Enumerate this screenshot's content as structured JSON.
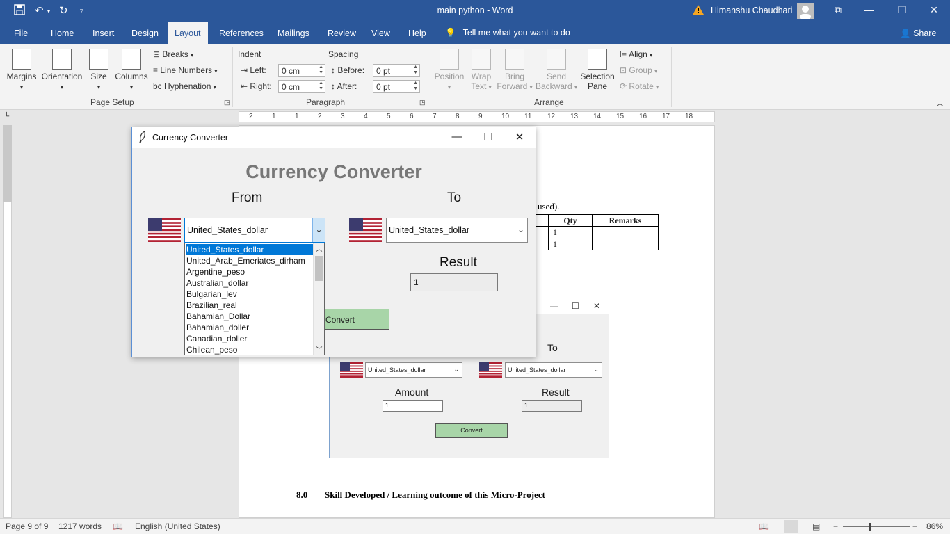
{
  "titlebar": {
    "doc_title": "main python  -  Word",
    "user_name": "Himanshu Chaudhari"
  },
  "tabs": [
    "File",
    "Home",
    "Insert",
    "Design",
    "Layout",
    "References",
    "Mailings",
    "Review",
    "View",
    "Help"
  ],
  "active_tab": "Layout",
  "tell_me": "Tell me what you want to do",
  "share": "Share",
  "ribbon": {
    "page_setup": {
      "label": "Page Setup",
      "margins": "Margins",
      "orientation": "Orientation",
      "size": "Size",
      "columns": "Columns",
      "breaks": "Breaks",
      "line_numbers": "Line Numbers",
      "hyphenation": "Hyphenation"
    },
    "paragraph": {
      "label": "Paragraph",
      "indent": "Indent",
      "spacing": "Spacing",
      "left": "Left:",
      "right": "Right:",
      "before": "Before:",
      "after": "After:",
      "left_value": "0 cm",
      "right_value": "0 cm",
      "before_value": "0 pt",
      "after_value": "0 pt"
    },
    "arrange": {
      "label": "Arrange",
      "position": "Position",
      "wrap_text_1": "Wrap",
      "wrap_text_2": "Text",
      "bring_forward_1": "Bring",
      "bring_forward_2": "Forward",
      "send_backward_1": "Send",
      "send_backward_2": "Backward",
      "selection_pane_1": "Selection",
      "selection_pane_2": "Pane",
      "align": "Align",
      "group": "Group",
      "rotate": "Rotate"
    }
  },
  "document": {
    "partial_text": "used).",
    "table_headers": [
      "Qty",
      "Remarks"
    ],
    "table_rows": [
      [
        "1",
        ""
      ],
      [
        "1",
        ""
      ]
    ],
    "heading_number": "8.0",
    "heading_text": "Skill Developed / Learning outcome of this Micro-Project"
  },
  "embedded_window": {
    "to_label": "To",
    "from_value": "United_States_dollar",
    "to_value": "United_States_dollar",
    "amount_label": "Amount",
    "result_label": "Result",
    "amount_value": "1",
    "result_value": "1",
    "convert": "Convert"
  },
  "converter": {
    "window_title": "Currency Converter",
    "heading": "Currency Converter",
    "from_label": "From",
    "to_label": "To",
    "from_value": "United_States_dollar",
    "to_value": "United_States_dollar",
    "result_label": "Result",
    "result_value": "1",
    "convert": "Convert",
    "dropdown_options": [
      "United_States_dollar",
      "United_Arab_Emeriates_dirham",
      "Argentine_peso",
      "Australian_dollar",
      "Bulgarian_lev",
      "Brazilian_real",
      "Bahamian_Dollar",
      "Bahamian_doller",
      "Canadian_doller",
      "Chilean_peso"
    ]
  },
  "ruler_numbers": [
    "2",
    "1",
    "1",
    "2",
    "3",
    "4",
    "5",
    "6",
    "7",
    "8",
    "9",
    "10",
    "11",
    "12",
    "13",
    "14",
    "15",
    "16",
    "17",
    "18"
  ],
  "status": {
    "page": "Page 9 of 9",
    "words": "1217 words",
    "language": "English (United States)",
    "zoom": "86%"
  },
  "colors": {
    "word_blue": "#2b579a",
    "convert_green": "#a8d5a8",
    "selection_blue": "#0078d7"
  }
}
